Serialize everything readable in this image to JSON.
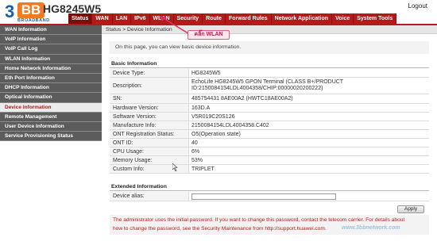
{
  "header": {
    "logo_number": "3",
    "logo_letters": "BB",
    "logo_sub": "BROADBAND",
    "model": "HG8245W5",
    "logout": "Logout"
  },
  "nav": {
    "tabs": [
      {
        "label": "Status",
        "active": true
      },
      {
        "label": "WAN"
      },
      {
        "label": "LAN"
      },
      {
        "label": "IPv6"
      },
      {
        "label": "WLAN"
      },
      {
        "label": "Security"
      },
      {
        "label": "Route"
      },
      {
        "label": "Forward Rules"
      },
      {
        "label": "Network Application"
      },
      {
        "label": "Voice"
      },
      {
        "label": "System Tools"
      }
    ]
  },
  "sidebar": {
    "items": [
      {
        "label": "WAN Information"
      },
      {
        "label": "VoIP Information"
      },
      {
        "label": "VoIP Call Log"
      },
      {
        "label": "WLAN Information"
      },
      {
        "label": "Home Network Information"
      },
      {
        "label": "Eth Port Information"
      },
      {
        "label": "DHCP Information"
      },
      {
        "label": "Optical Information"
      },
      {
        "label": "Device Information",
        "active": true
      },
      {
        "label": "Remote Management"
      },
      {
        "label": "User Device Information"
      },
      {
        "label": "Service Provisioning Status"
      }
    ]
  },
  "content": {
    "breadcrumb": "Status > Device Information",
    "notice": "On this page, you can view basic device information.",
    "basic_title": "Basic Information",
    "rows": [
      {
        "label": "Device Type:",
        "value": "HG8245W5"
      },
      {
        "label": "Description:",
        "value": "EchoLife HG8245W5 GPON Terminal (CLASS B+/PRODUCT",
        "value2": "ID:2150084154LDL4004358/CHIP:00000020200222)"
      },
      {
        "label": "SN:",
        "value": "485754431 8AE00A2 (HWTC18AE00A2)"
      },
      {
        "label": "Hardware Version:",
        "value": "163D.A"
      },
      {
        "label": "Software Version:",
        "value": "V5R019C20S126"
      },
      {
        "label": "Manufacture Info:",
        "value": "2150084154LDL4004358.C402"
      },
      {
        "label": "ONT Registration Status:",
        "value": "O5(Operation state)"
      },
      {
        "label": "ONT ID:",
        "value": "40"
      },
      {
        "label": "CPU Usage:",
        "value": "6%"
      },
      {
        "label": "Memory Usage:",
        "value": "53%"
      },
      {
        "label": "Custom Info:",
        "value": "TRIPLET"
      }
    ],
    "extended_title": "Extended Information",
    "alias_label": "Device alias:",
    "alias_value": "",
    "apply": "Apply",
    "warning_line1": "The administrator uses the initial password. If you want to change this password, contact the telecom carrier. For details about",
    "warning_line2": "how to change the password, see the Security Maintenance from http://support.huawei.com."
  },
  "annotation": {
    "label": "คลิ๊ก WLAN",
    "watermark": "www.3bbnetwork.com"
  },
  "colors": {
    "brand_red": "#b31b1b",
    "brand_orange": "#f47a20",
    "brand_blue": "#1a5fa8",
    "sidebar_bg": "#5c5c5c",
    "warning_red": "#c21a1a"
  }
}
